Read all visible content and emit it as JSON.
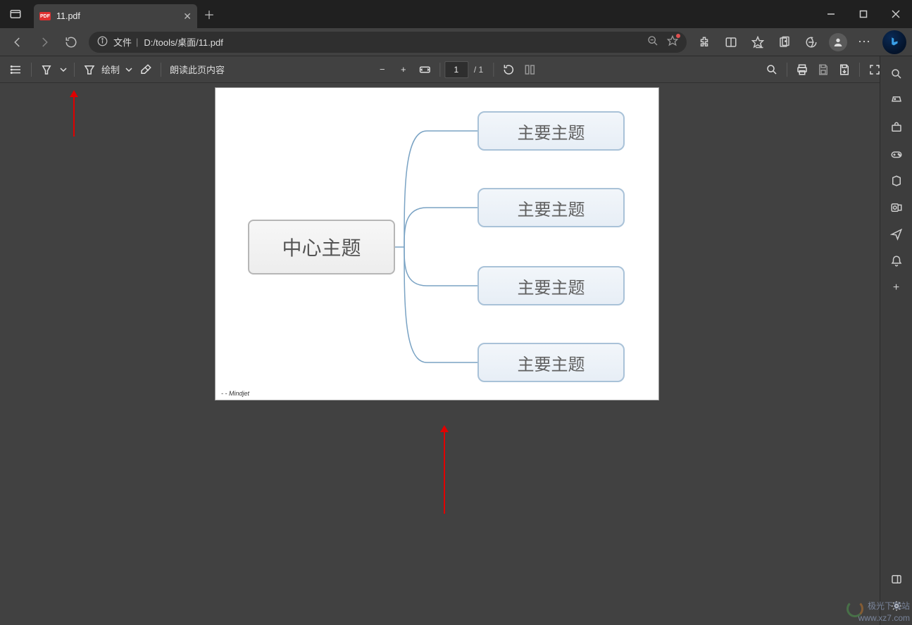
{
  "window": {
    "tab_title": "11.pdf"
  },
  "address": {
    "file_label": "文件",
    "path": "D:/tools/桌面/11.pdf"
  },
  "pdf_toolbar": {
    "draw_label": "绘制",
    "read_aloud_label": "朗读此页内容",
    "page_current": "1",
    "page_total_prefix": "/ 1"
  },
  "document": {
    "center_node": "中心主题",
    "sub_nodes": [
      "主要主题",
      "主要主题",
      "主要主题",
      "主要主题"
    ],
    "footer": "- - Mindjet"
  },
  "watermark": {
    "line1": "极光下载站",
    "line2": "www.xz7.com"
  }
}
